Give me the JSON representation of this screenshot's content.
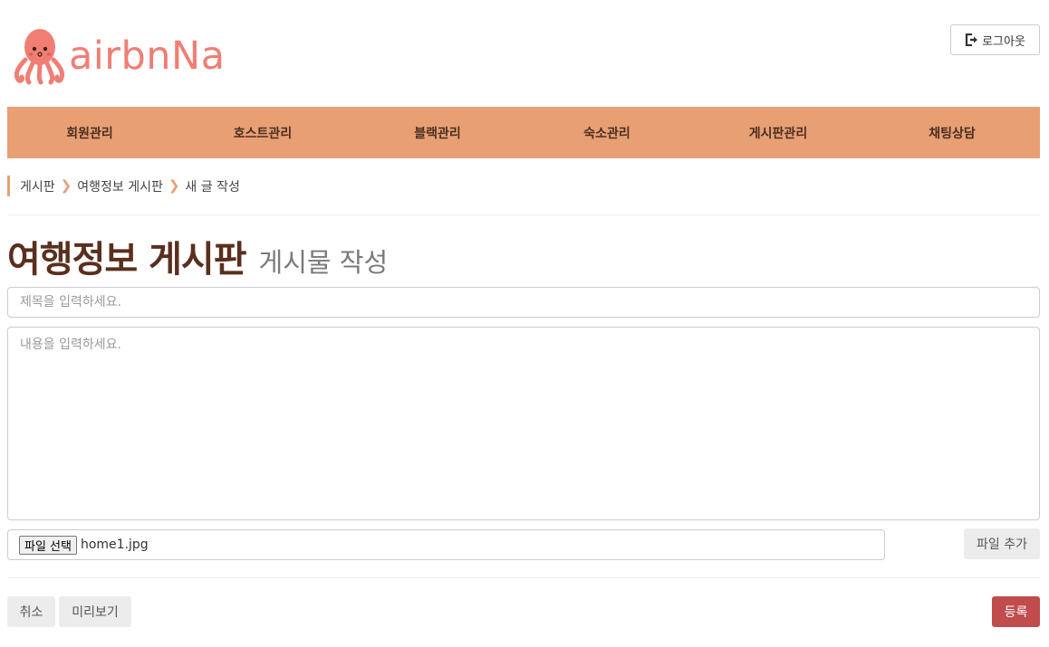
{
  "brand": {
    "name": "airbnNa",
    "color": "#f07e74"
  },
  "header": {
    "logout_label": "로그아웃",
    "logout_icon": "sign-out-icon"
  },
  "nav": {
    "background": "#e89f74",
    "items": [
      {
        "label": "회원관리"
      },
      {
        "label": "호스트관리"
      },
      {
        "label": "블랙관리"
      },
      {
        "label": "숙소관리"
      },
      {
        "label": "게시판관리"
      },
      {
        "label": "채팅상담"
      }
    ]
  },
  "breadcrumb": [
    "게시판",
    "여행정보 게시판",
    "새 글 작성"
  ],
  "page": {
    "title": "여행정보 게시판",
    "subtitle": "게시물 작성"
  },
  "form": {
    "title_placeholder": "제목을 입력하세요.",
    "content_placeholder": "내용을 입력하세요.",
    "file_choose_label": "파일 선택",
    "file_name": "home1.jpg",
    "add_file_label": "파일 추가"
  },
  "actions": {
    "cancel_label": "취소",
    "preview_label": "미리보기",
    "submit_label": "등록",
    "submit_color": "#c14c4c"
  }
}
